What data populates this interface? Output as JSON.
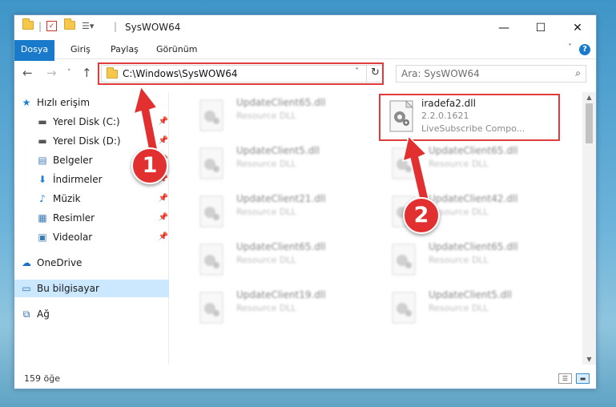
{
  "window": {
    "title": "SysWOW64",
    "controls": {
      "minimize": "—",
      "maximize": "☐",
      "close": "✕"
    }
  },
  "ribbon": {
    "tabs": [
      "Dosya",
      "Giriş",
      "Paylaş",
      "Görünüm"
    ],
    "help": "?"
  },
  "nav": {
    "address": "C:\\Windows\\SysWOW64",
    "search_placeholder": "Ara: SysWOW64"
  },
  "sidebar": {
    "quick_access": "Hızlı erişim",
    "items": [
      {
        "label": "Yerel Disk (C:)",
        "icon": "drive-icon",
        "pinned": true
      },
      {
        "label": "Yerel Disk (D:)",
        "icon": "drive-icon",
        "pinned": true
      },
      {
        "label": "Belgeler",
        "icon": "documents-icon",
        "pinned": true
      },
      {
        "label": "İndirmeler",
        "icon": "download-icon",
        "pinned": true
      },
      {
        "label": "Müzik",
        "icon": "music-icon",
        "pinned": true
      },
      {
        "label": "Resimler",
        "icon": "pictures-icon",
        "pinned": true
      },
      {
        "label": "Videolar",
        "icon": "videos-icon",
        "pinned": true
      }
    ],
    "onedrive": "OneDrive",
    "this_pc": "Bu bilgisayar",
    "network": "Ağ"
  },
  "files": {
    "highlight": {
      "name": "iradefa2.dll",
      "version": "2.2.0.1621",
      "description": "LiveSubscribe Compo..."
    },
    "blurred": [
      {
        "name": "UpdateClient65.dll",
        "type": "Resource DLL"
      },
      {
        "name": "UpdateClient5.dll",
        "type": "Resource DLL"
      },
      {
        "name": "UpdateClient21.dll",
        "type": "Resource DLL"
      },
      {
        "name": "UpdateClient65.dll",
        "type": "Resource DLL"
      },
      {
        "name": "UpdateClient19.dll",
        "type": "Resource DLL"
      },
      {
        "name": "UpdateClient65.dll",
        "type": "Resource DLL"
      },
      {
        "name": "UpdateClient42.dll",
        "type": "Resource DLL"
      },
      {
        "name": "UpdateClient65.dll",
        "type": "Resource DLL"
      },
      {
        "name": "UpdateClient5.dll",
        "type": "Resource DLL"
      }
    ]
  },
  "status": {
    "item_count": "159 öğe"
  },
  "callouts": {
    "one": "1",
    "two": "2"
  },
  "colors": {
    "accent": "#1979ca",
    "highlight_red": "#e03c3c",
    "selected": "#cce8ff"
  }
}
